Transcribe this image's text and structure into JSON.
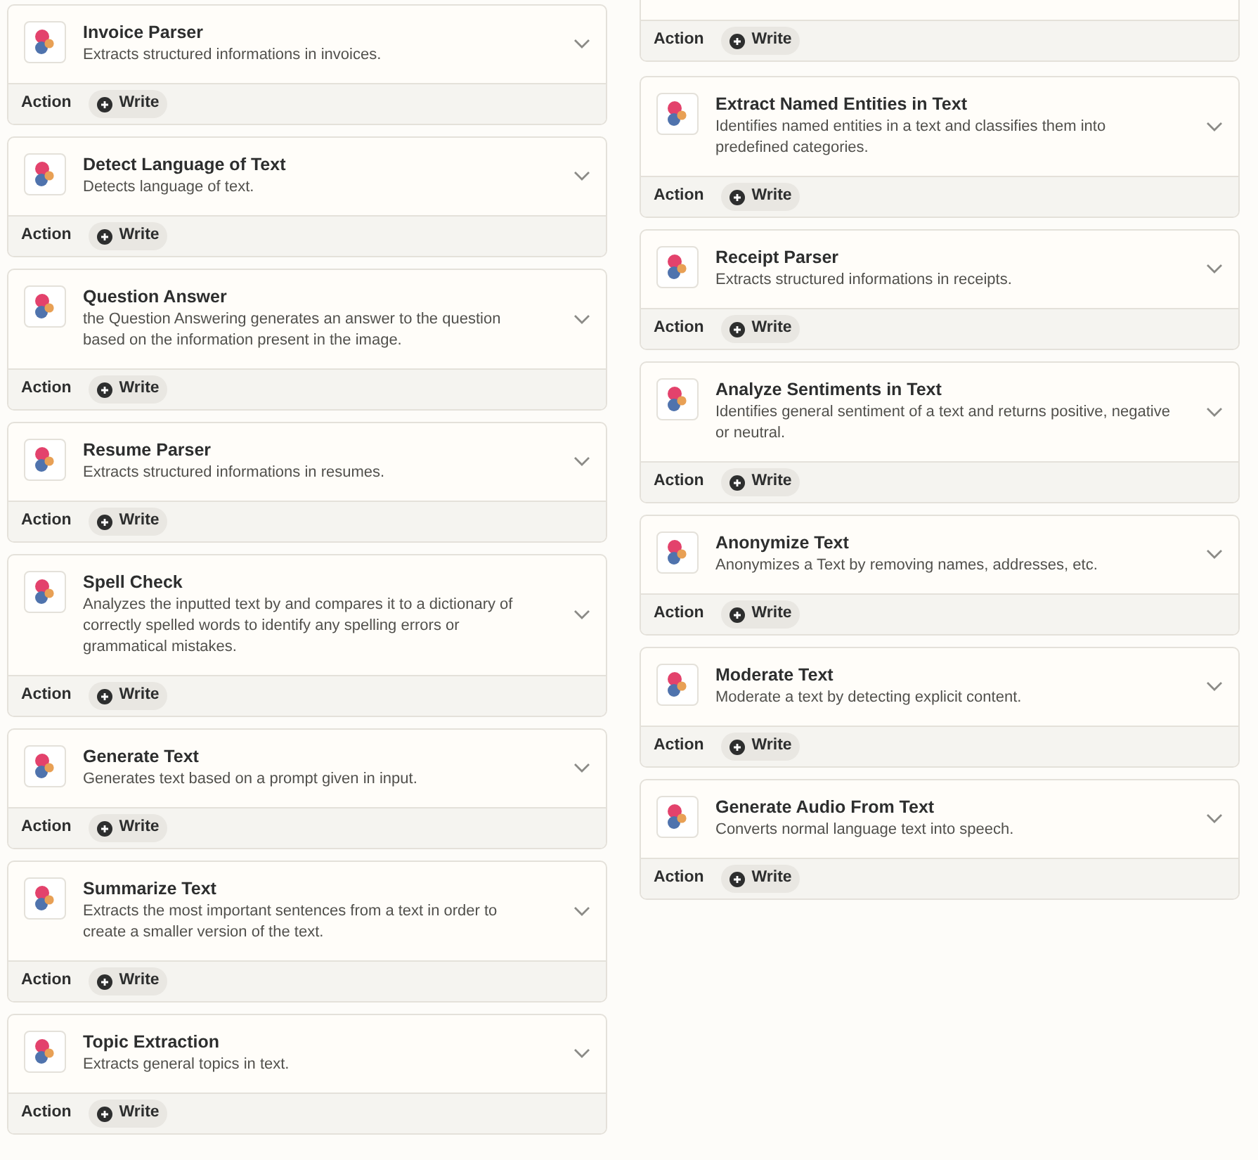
{
  "columns": [
    {
      "cards": [
        {
          "title": "Invoice Parser",
          "description": "Extracts structured informations in invoices.",
          "footer_label": "Action",
          "badge": "Write"
        },
        {
          "title": "Detect Language of Text",
          "description": "Detects language of text.",
          "footer_label": "Action",
          "badge": "Write"
        },
        {
          "title": "Question Answer",
          "description": "the Question Answering generates an answer to the question based on the information present in the image.",
          "footer_label": "Action",
          "badge": "Write"
        },
        {
          "title": "Resume Parser",
          "description": "Extracts structured informations in resumes.",
          "footer_label": "Action",
          "badge": "Write"
        },
        {
          "title": "Spell Check",
          "description": "Analyzes the inputted text by and compares it to a dictionary of correctly spelled words to identify any spelling errors or grammatical mistakes.",
          "footer_label": "Action",
          "badge": "Write"
        },
        {
          "title": "Generate Text",
          "description": "Generates text based on a prompt given in input.",
          "footer_label": "Action",
          "badge": "Write"
        },
        {
          "title": "Summarize Text",
          "description": "Extracts the most important sentences from a text in order to create a smaller version of the text.",
          "footer_label": "Action",
          "badge": "Write"
        },
        {
          "title": "Topic Extraction",
          "description": "Extracts general topics in text.",
          "footer_label": "Action",
          "badge": "Write"
        }
      ]
    },
    {
      "partial_card": {
        "footer_label": "Action",
        "badge": "Write"
      },
      "cards": [
        {
          "title": "Extract Named Entities in Text",
          "description": "Identifies named entities in a text and classifies them into predefined categories.",
          "footer_label": "Action",
          "badge": "Write"
        },
        {
          "title": "Receipt Parser",
          "description": "Extracts structured informations in receipts.",
          "footer_label": "Action",
          "badge": "Write"
        },
        {
          "title": "Analyze Sentiments in Text",
          "description": "Identifies general sentiment of a text and returns positive, negative or neutral.",
          "footer_label": "Action",
          "badge": "Write"
        },
        {
          "title": "Anonymize Text",
          "description": "Anonymizes a Text by removing names, addresses, etc.",
          "footer_label": "Action",
          "badge": "Write"
        },
        {
          "title": "Moderate Text",
          "description": "Moderate a text by detecting explicit content.",
          "footer_label": "Action",
          "badge": "Write"
        },
        {
          "title": "Generate Audio From Text",
          "description": "Converts normal language text into speech.",
          "footer_label": "Action",
          "badge": "Write"
        }
      ]
    }
  ]
}
